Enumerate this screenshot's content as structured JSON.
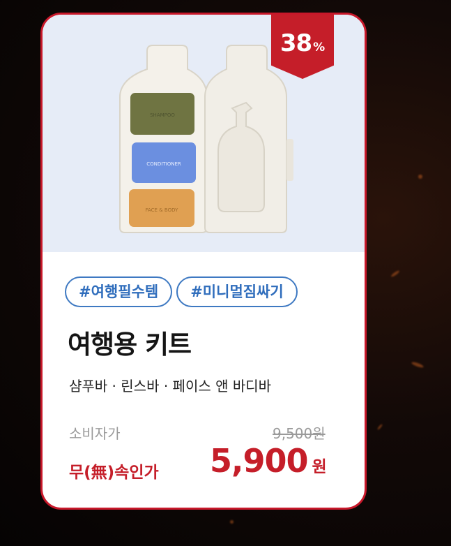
{
  "product": {
    "discount": {
      "value": "38",
      "unit": "%"
    },
    "tags": [
      "#여행필수템",
      "#미니멀짐싸기"
    ],
    "name": "여행용 키트",
    "components": "샴푸바 · 린스바 · 페이스 앤 바디바",
    "image_text": {
      "bar1": "SHAMPOO",
      "bar2": "CONDITIONER",
      "bar3": "FACE & BODY"
    },
    "retail": {
      "label": "소비자가",
      "price": "9,500원"
    },
    "sale": {
      "label": "무(無)속인가",
      "amount": "5,900",
      "currency": "원"
    }
  },
  "colors": {
    "accent": "#c51e29",
    "tag_blue": "#3e79c2",
    "hero_bg": "#e6ecf7"
  }
}
